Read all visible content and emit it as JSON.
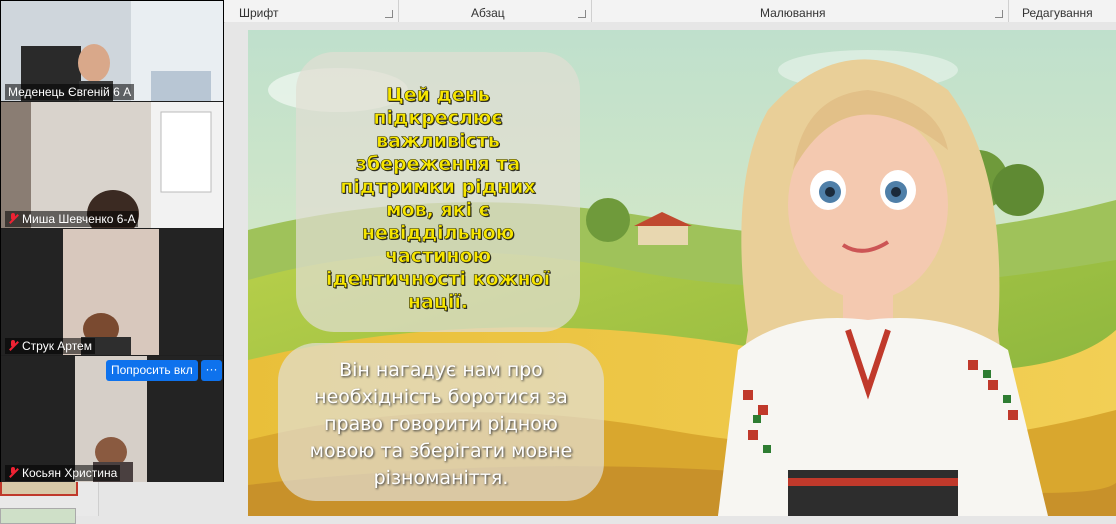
{
  "ribbon": {
    "groups": [
      {
        "label": "Шрифт"
      },
      {
        "label": "Абзац"
      },
      {
        "label": "Малювання"
      },
      {
        "label": "Редагування"
      }
    ]
  },
  "slide": {
    "bubble_top": [
      "Цей день",
      "підкреслює",
      "важливість",
      "збереження та",
      "підтримки рідних",
      "мов, які є",
      "невіддільною",
      "частиною",
      "ідентичності кожної",
      "нації."
    ],
    "bubble_bottom": [
      "Він нагадує нам про",
      "необхідність боротися за",
      "право говорити рідною",
      "мовою та зберігати мовне",
      "різноманіття."
    ]
  },
  "zoom": {
    "participants": [
      {
        "name": "Меденець Євгеній 6 А",
        "muted": false
      },
      {
        "name": "Миша Шевченко 6-А",
        "muted": true
      },
      {
        "name": "Струк Артем",
        "muted": true
      },
      {
        "name": "Косьян Христина",
        "muted": true
      }
    ],
    "ask_button": "Попросить вкл",
    "more_button": "···"
  }
}
